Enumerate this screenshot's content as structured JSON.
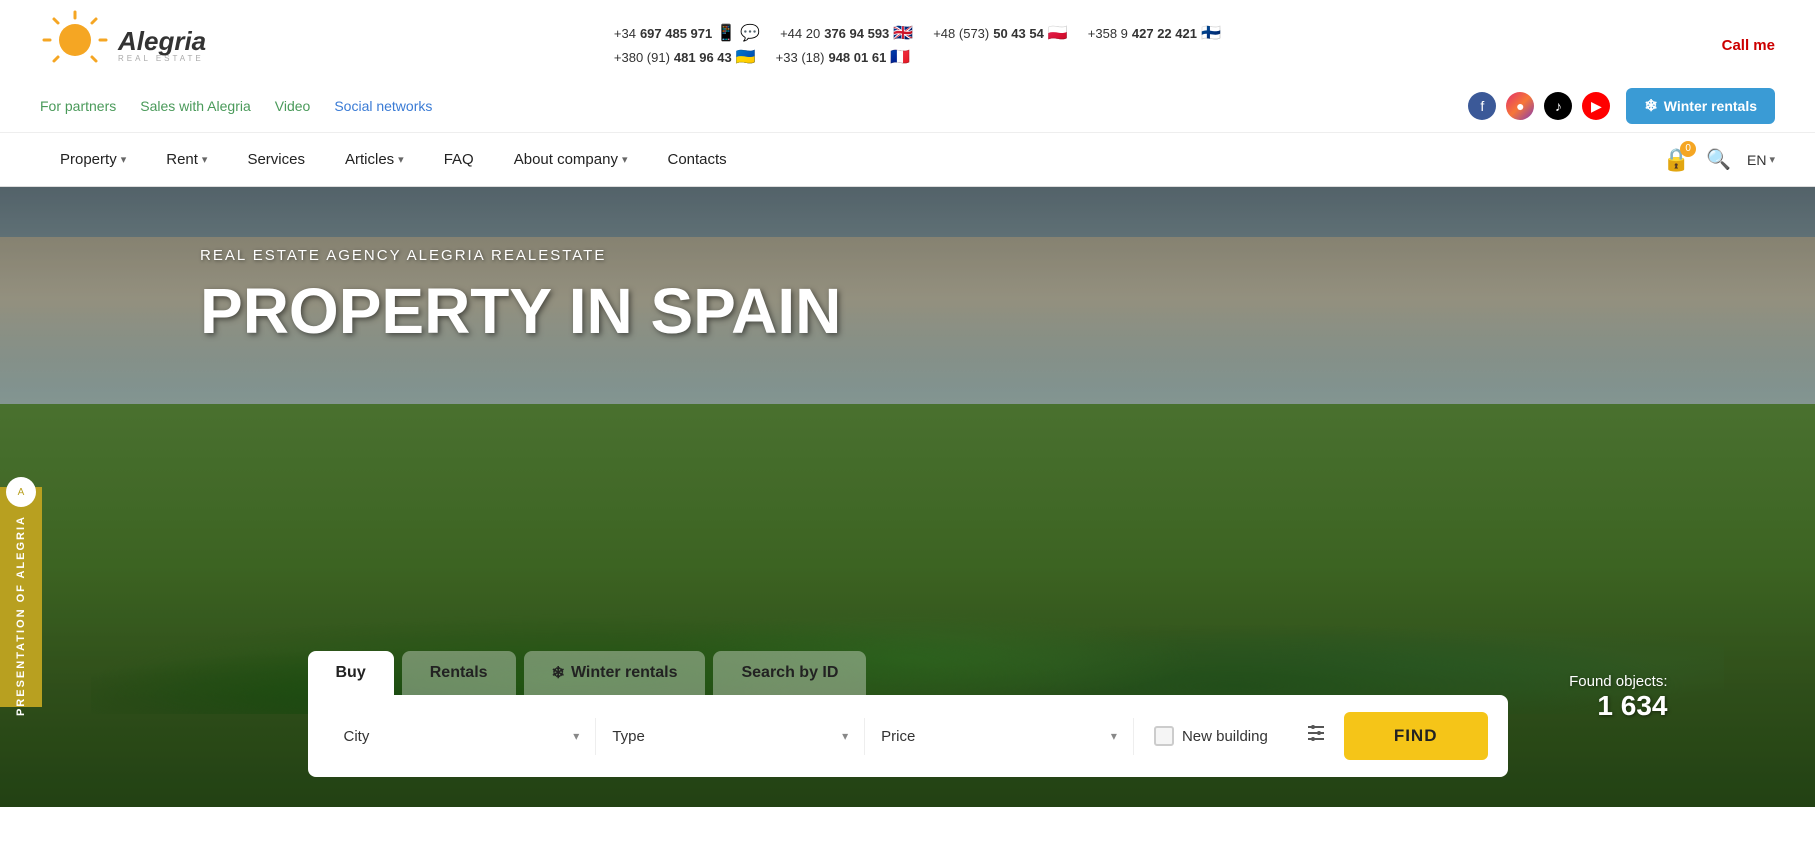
{
  "topbar": {
    "phones": [
      {
        "number": "+34 697 485 971",
        "bold": "697 485 971",
        "prefix": "+34",
        "flag": "📱",
        "icons": [
          "📱",
          "💬"
        ]
      },
      {
        "number": "+44 20 376 94 593",
        "bold": "376 94 593",
        "prefix": "+44 20",
        "flag": "🇬🇧"
      },
      {
        "number": "+48 (573) 50 43 54",
        "bold": "50 43 54",
        "prefix": "+48 (573)",
        "flag": "🇵🇱"
      },
      {
        "number": "+358 9 427 22 421",
        "bold": "427 22 421",
        "prefix": "+358 9",
        "flag": "🇫🇮"
      },
      {
        "number": "+380 (91) 481 96 43",
        "bold": "481 96 43",
        "prefix": "+380 (91)",
        "flag": "🇺🇦"
      },
      {
        "number": "+33 (18) 948 01 61",
        "bold": "948 01 61",
        "prefix": "+33 (18)",
        "flag": "🇫🇷"
      }
    ],
    "call_me": "Call me"
  },
  "secondary_nav": {
    "links": [
      {
        "label": "For partners",
        "color": "green"
      },
      {
        "label": "Sales with Alegria",
        "color": "green"
      },
      {
        "label": "Video",
        "color": "green"
      },
      {
        "label": "Social networks",
        "color": "blue"
      }
    ],
    "winter_rentals_btn": "Winter rentals"
  },
  "main_nav": {
    "items": [
      {
        "label": "Property",
        "has_chevron": true
      },
      {
        "label": "Rent",
        "has_chevron": true
      },
      {
        "label": "Services",
        "has_chevron": false
      },
      {
        "label": "Articles",
        "has_chevron": true
      },
      {
        "label": "FAQ",
        "has_chevron": false
      },
      {
        "label": "About company",
        "has_chevron": true
      },
      {
        "label": "Contacts",
        "has_chevron": false
      }
    ],
    "heart_count": "0",
    "lang": "EN"
  },
  "hero": {
    "subtitle": "REAL ESTATE AGENCY ALEGRIA REALESTATE",
    "title": "PROPERTY IN SPAIN",
    "side_label": "PRESENTATION OF ALEGRIA"
  },
  "search": {
    "tabs": [
      {
        "label": "Buy",
        "active": true
      },
      {
        "label": "Rentals",
        "active": false
      },
      {
        "label": "Winter rentals",
        "active": false,
        "has_snowflake": true
      },
      {
        "label": "Search by ID",
        "active": false
      }
    ],
    "city_placeholder": "City",
    "type_placeholder": "Type",
    "price_placeholder": "Price",
    "new_building_label": "New building",
    "find_label": "FIND",
    "found_label": "Found objects:",
    "found_count": "1 634"
  }
}
